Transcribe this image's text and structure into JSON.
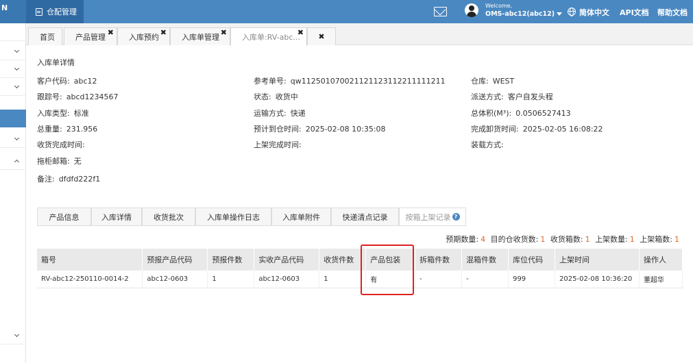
{
  "topbar": {
    "brand": "N",
    "module": "仓配管理",
    "welcome": "Welcome,",
    "user": "OMS-abc12(abc12)",
    "language": "简体中文",
    "api_docs": "API文档",
    "help_docs": "帮助文档",
    "color": "#4a88c1"
  },
  "tabs": [
    {
      "label": "首页"
    },
    {
      "label": "产品管理"
    },
    {
      "label": "入库预约"
    },
    {
      "label": "入库单管理"
    },
    {
      "label": "入库单:RV-abc..."
    }
  ],
  "detail": {
    "title": "入库单详情",
    "fields": [
      {
        "label": "客户代码:",
        "value": "abc12"
      },
      {
        "label": "参考单号:",
        "value": "qw112501070021121123112211111211"
      },
      {
        "label": "仓库:",
        "value": "WEST"
      },
      {
        "label": "跟踪号:",
        "value": "abcd1234567"
      },
      {
        "label": "状态:",
        "value": "收货中"
      },
      {
        "label": "派送方式:",
        "value": "客户自发头程"
      },
      {
        "label": "入库类型:",
        "value": "标准"
      },
      {
        "label": "运输方式:",
        "value": "快递"
      },
      {
        "label": "总体积(M³):",
        "value": "0.0506527413"
      },
      {
        "label": "总重量:",
        "value": "231.956"
      },
      {
        "label": "预计到仓时间:",
        "value": "2025-02-08 10:35:08"
      },
      {
        "label": "完成卸货时间:",
        "value": "2025-02-05 16:08:22"
      },
      {
        "label": "收货完成时间:",
        "value": ""
      },
      {
        "label": "上架完成时间:",
        "value": ""
      },
      {
        "label": "装载方式:",
        "value": ""
      },
      {
        "label": "拖柜邮箱:",
        "value": "无"
      },
      {
        "label": "备注:",
        "value": "dfdfd222f1"
      }
    ]
  },
  "subtabs": [
    {
      "label": "产品信息"
    },
    {
      "label": "入库详情"
    },
    {
      "label": "收货批次"
    },
    {
      "label": "入库单操作日志"
    },
    {
      "label": "入库单附件"
    },
    {
      "label": "快递清点记录"
    },
    {
      "label": "按箱上架记录"
    }
  ],
  "summary": {
    "expected_label": "预期数量:",
    "expected": "4",
    "received_label": "目的仓收货数:",
    "received": "1",
    "boxes_label": "收货箱数:",
    "boxes": "1",
    "shelved_label": "上架数量:",
    "shelved": "1",
    "shelved_boxes_label": "上架箱数:",
    "shelved_boxes": "1"
  },
  "table": {
    "headers": [
      "箱号",
      "预报产品代码",
      "预报件数",
      "实收产品代码",
      "收货件数",
      "产品包装",
      "拆箱件数",
      "混箱件数",
      "库位代码",
      "上架时间",
      "操作人"
    ],
    "rows": [
      [
        "RV-abc12-250110-0014-2",
        "abc12-0603",
        "1",
        "abc12-0603",
        "1",
        "有",
        "-",
        "-",
        "999",
        "2025-02-08 10:36:20",
        "董超华"
      ]
    ]
  }
}
